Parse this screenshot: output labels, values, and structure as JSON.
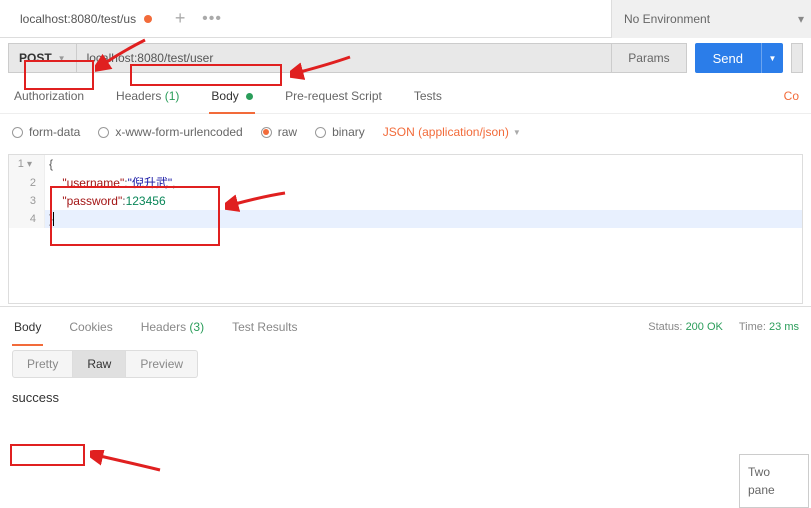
{
  "tab": {
    "title": "localhost:8080/test/us"
  },
  "environment": {
    "label": "No Environment"
  },
  "request": {
    "method": "POST",
    "url": "localhost:8080/test/user",
    "params_label": "Params",
    "send_label": "Send"
  },
  "req_tabs": {
    "auth": "Authorization",
    "headers": "Headers",
    "headers_count": "(1)",
    "body": "Body",
    "prerequest": "Pre-request Script",
    "tests": "Tests",
    "cookies": "Co"
  },
  "body_types": {
    "formdata": "form-data",
    "urlencoded": "x-www-form-urlencoded",
    "raw": "raw",
    "binary": "binary",
    "content_type": "JSON (application/json)"
  },
  "editor": {
    "l1": "{",
    "l2_key": "\"username\"",
    "l2_val": "\"倪升武\"",
    "l3_key": "\"password\"",
    "l3_val": "123456",
    "l4": "}",
    "n1": "1",
    "n2": "2",
    "n3": "3",
    "n4": "4"
  },
  "response": {
    "tabs": {
      "body": "Body",
      "cookies": "Cookies",
      "headers": "Headers",
      "headers_count": "(3)",
      "tests": "Test Results"
    },
    "status_label": "Status:",
    "status_value": "200 OK",
    "time_label": "Time:",
    "time_value": "23 ms",
    "views": {
      "pretty": "Pretty",
      "raw": "Raw",
      "preview": "Preview"
    },
    "body_text": "success"
  },
  "side": {
    "line1": "Two",
    "line2": "pane"
  }
}
